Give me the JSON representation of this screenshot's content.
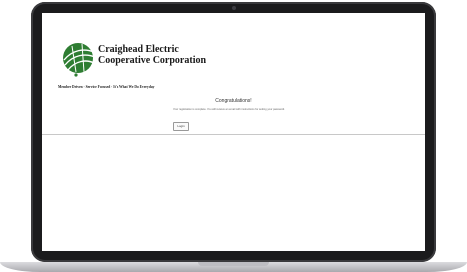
{
  "site": {
    "company_line1": "Craighead Electric",
    "company_line2": "Cooperative Corporation",
    "tagline": "Member Driven  ·  Service Focused  ·  It's What We Do Everyday"
  },
  "content": {
    "heading": "Congratulations!",
    "message": "Your registration is complete. You will receive an email with instructions for setting your password.",
    "login_label": "Login"
  },
  "colors": {
    "logo_green": "#2e7d32",
    "bezel": "#1b1b1d"
  },
  "icons": {
    "logo": "globe-power-lines-icon"
  }
}
